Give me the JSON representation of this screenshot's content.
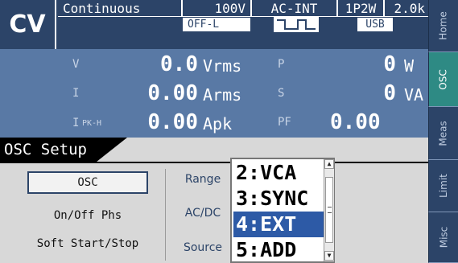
{
  "status": {
    "mode": "CV",
    "osc_mode": "Continuous",
    "range": "100V",
    "coupling": "AC-INT",
    "wiring": "1P2W",
    "frequency": "2.0k",
    "overload": "OFF-L",
    "interface": "USB",
    "waveform_icon": "waveform-icon"
  },
  "measurements": [
    {
      "label": "V",
      "value": "0.0",
      "unit": "Vrms"
    },
    {
      "label": "I",
      "value": "0.00",
      "unit": "Arms"
    },
    {
      "label": "I",
      "label_sub": "PK-H",
      "value": "0.00",
      "unit": "Apk"
    }
  ],
  "measurements_right": [
    {
      "label": "P",
      "value": "0",
      "unit": "W"
    },
    {
      "label": "S",
      "value": "0",
      "unit": "VA"
    },
    {
      "label": "PF",
      "value": "0.00",
      "unit": ""
    }
  ],
  "setup": {
    "title": "OSC Setup",
    "menu": [
      "OSC",
      "On/Off Phs",
      "Soft Start/Stop"
    ],
    "params": [
      "Range",
      "AC/DC",
      "Source"
    ]
  },
  "listbox": {
    "items": [
      "2:VCA",
      "3:SYNC",
      "4:EXT",
      "5:ADD"
    ],
    "selected_index": 2
  },
  "side_tabs": [
    "Home",
    "OSC",
    "Meas",
    "Limit",
    "Misc"
  ],
  "active_side_tab": "OSC",
  "colors": {
    "header_bg": "#2c4468",
    "measure_bg": "#5979a5",
    "selection": "#2d5aa6",
    "active_tab": "#2e8a84"
  }
}
